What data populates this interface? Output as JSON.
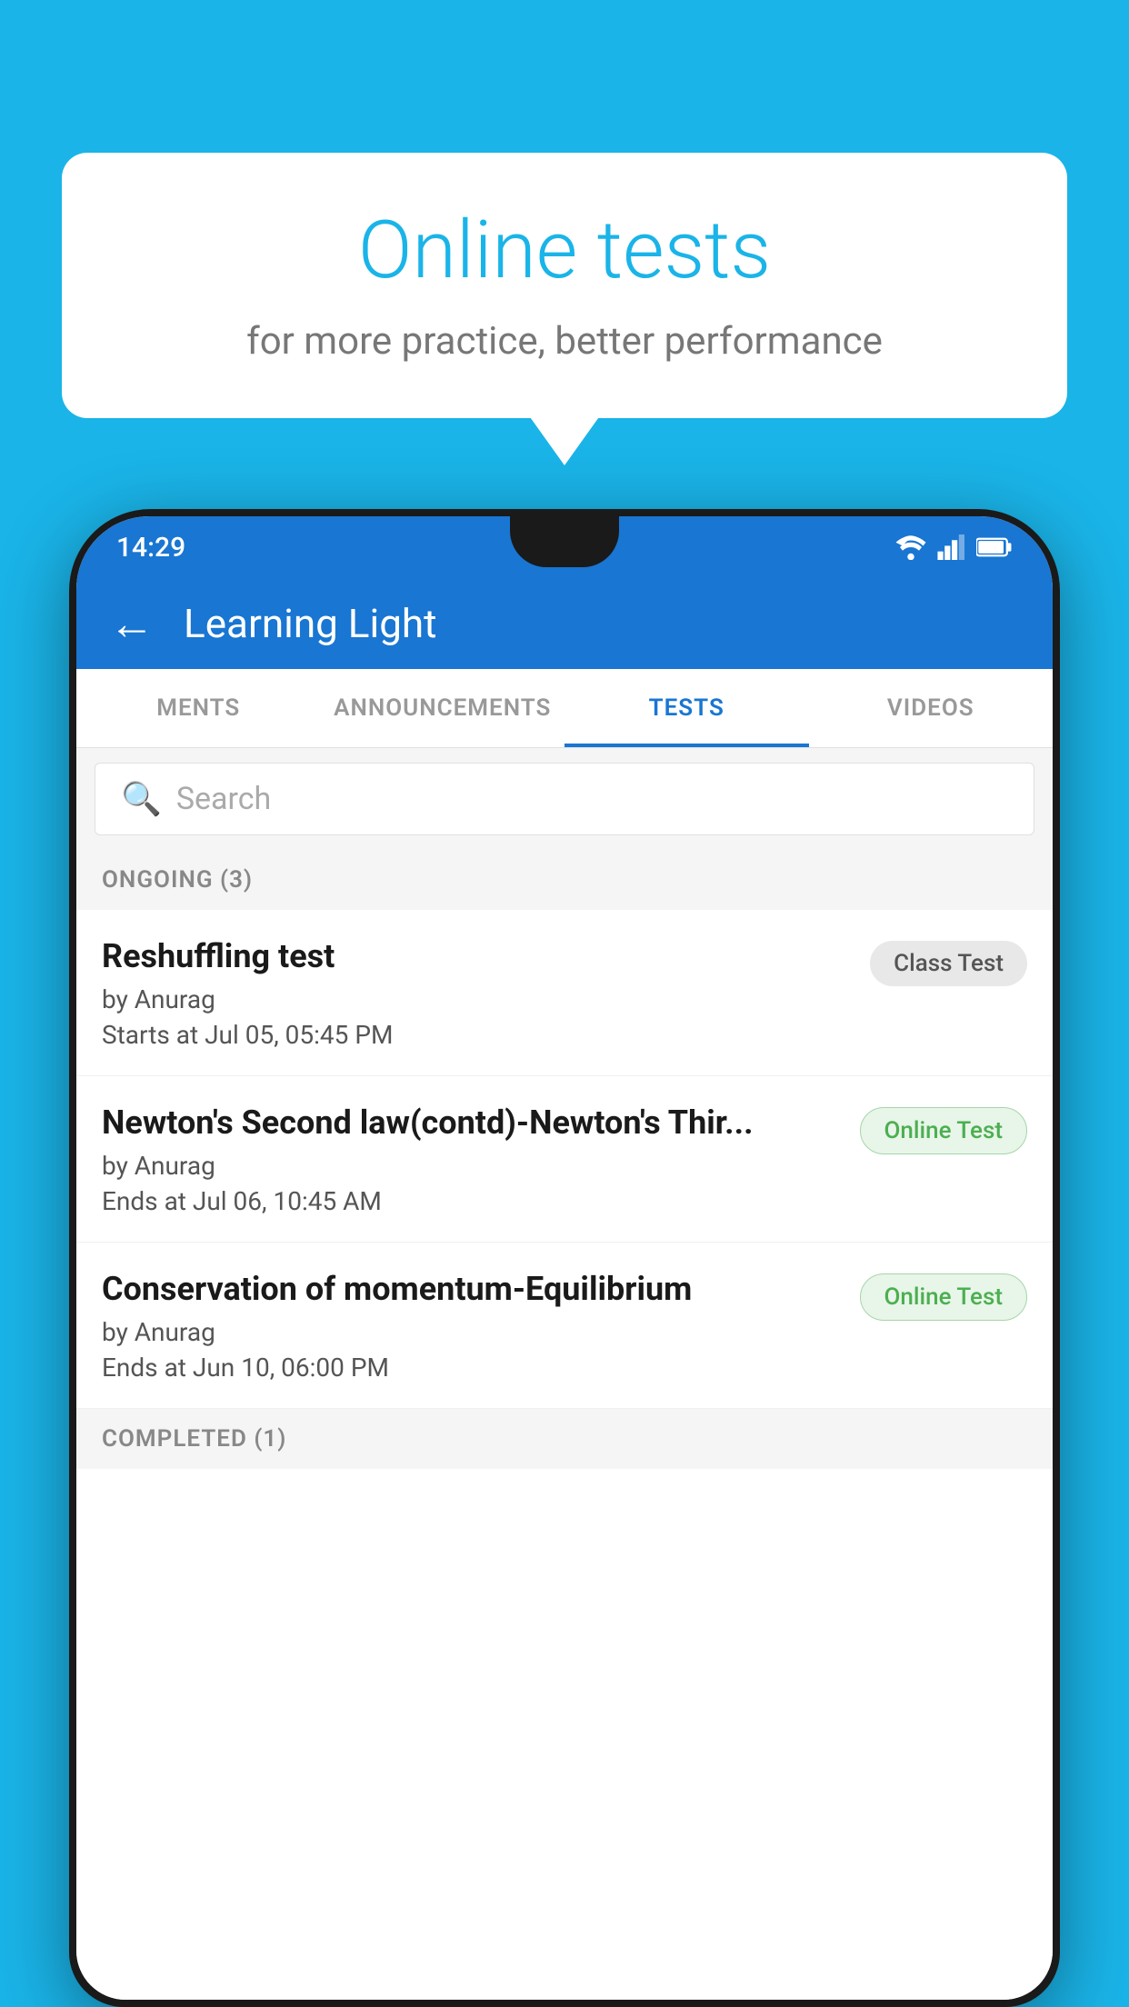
{
  "background_color": "#1ab4e8",
  "speech_bubble": {
    "title": "Online tests",
    "subtitle": "for more practice, better performance"
  },
  "status_bar": {
    "time": "14:29",
    "wifi_icon": "wifi-icon",
    "signal_icon": "signal-icon",
    "battery_icon": "battery-icon"
  },
  "app_bar": {
    "back_label": "←",
    "title": "Learning Light"
  },
  "tabs": [
    {
      "label": "MENTS",
      "active": false
    },
    {
      "label": "ANNOUNCEMENTS",
      "active": false
    },
    {
      "label": "TESTS",
      "active": true
    },
    {
      "label": "VIDEOS",
      "active": false
    }
  ],
  "search": {
    "placeholder": "Search"
  },
  "ongoing_section": {
    "label": "ONGOING (3)"
  },
  "tests": [
    {
      "name": "Reshuffling test",
      "author": "by Anurag",
      "time_label": "Starts at",
      "time": "Jul 05, 05:45 PM",
      "badge": "Class Test",
      "badge_type": "class"
    },
    {
      "name": "Newton's Second law(contd)-Newton's Thir...",
      "author": "by Anurag",
      "time_label": "Ends at",
      "time": "Jul 06, 10:45 AM",
      "badge": "Online Test",
      "badge_type": "online"
    },
    {
      "name": "Conservation of momentum-Equilibrium",
      "author": "by Anurag",
      "time_label": "Ends at",
      "time": "Jun 10, 06:00 PM",
      "badge": "Online Test",
      "badge_type": "online"
    }
  ],
  "completed_section": {
    "label": "COMPLETED (1)"
  }
}
